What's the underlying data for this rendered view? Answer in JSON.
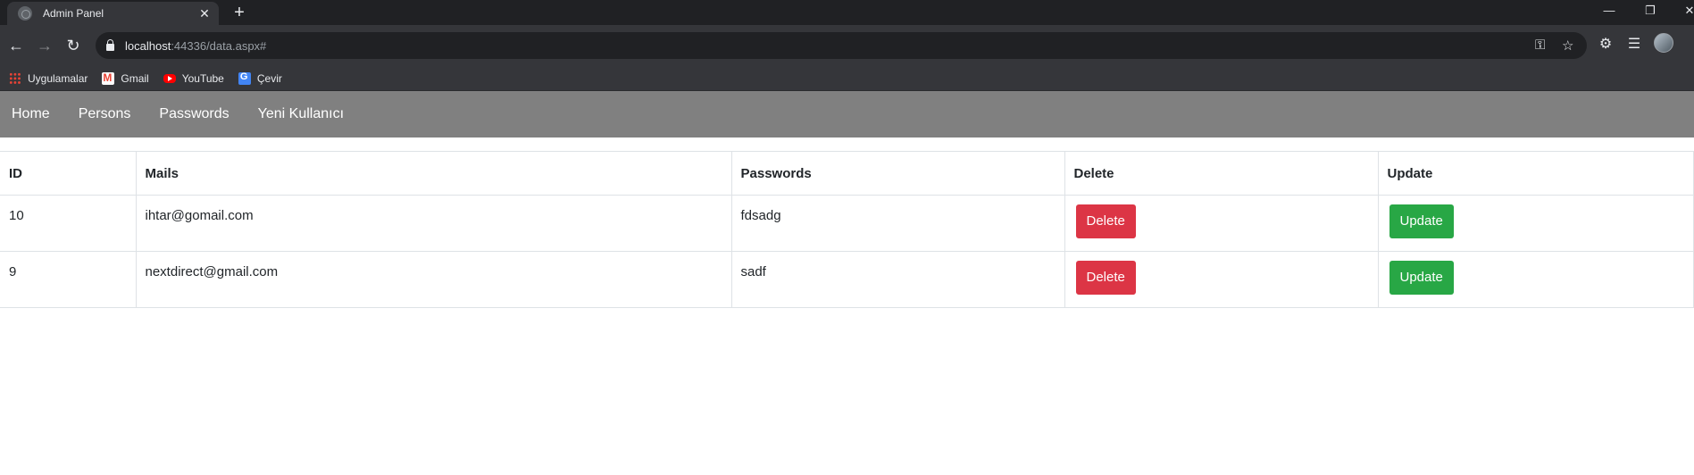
{
  "browser": {
    "tab_title": "Admin Panel",
    "tab_close": "✕",
    "new_tab": "+",
    "url_host": "localhost",
    "url_path": ":44336/data.aspx#",
    "window_controls": [
      "—",
      "❐",
      "✕"
    ],
    "nav_icons": [
      "back-arrow-icon",
      "forward-arrow-icon",
      "reload-icon"
    ],
    "bookmarks": [
      {
        "label": "Uygulamalar",
        "icon": "apps-grid-icon"
      },
      {
        "label": "Gmail",
        "icon": "gmail-icon"
      },
      {
        "label": "YouTube",
        "icon": "youtube-icon"
      },
      {
        "label": "Çevir",
        "icon": "translate-icon"
      }
    ]
  },
  "navbar": {
    "items": [
      "Home",
      "Persons",
      "Passwords",
      "Yeni Kullanıcı"
    ]
  },
  "table": {
    "headers": [
      "ID",
      "Mails",
      "Passwords",
      "Delete",
      "Update"
    ],
    "rows": [
      {
        "id": "10",
        "mail": "ihtar@gomail.com",
        "password": "fdsadg",
        "delete": "Delete",
        "update": "Update"
      },
      {
        "id": "9",
        "mail": "nextdirect@gmail.com",
        "password": "sadf",
        "delete": "Delete",
        "update": "Update"
      }
    ]
  },
  "colors": {
    "navbar_bg": "#808080",
    "delete_button": "#dc3545",
    "update_button": "#28a745",
    "browser_dark": "#202124",
    "browser_toolbar": "#35363a"
  }
}
